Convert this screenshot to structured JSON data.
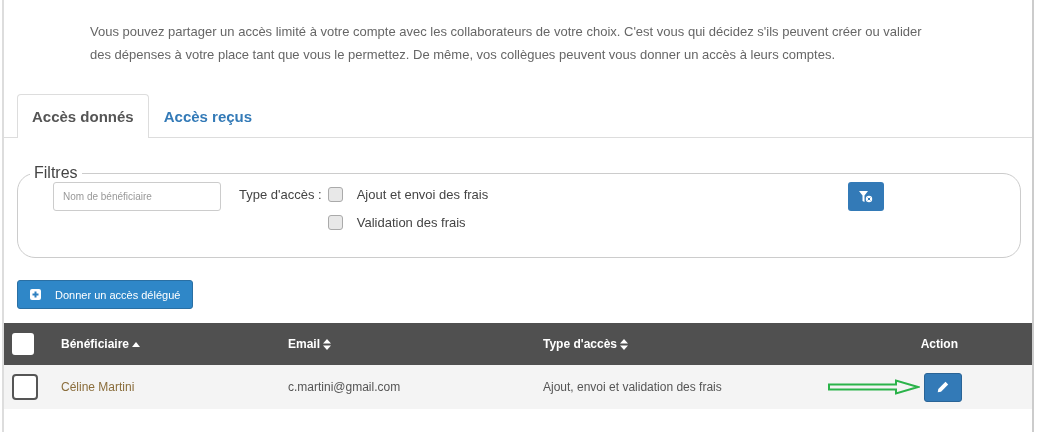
{
  "intro": "Vous pouvez partager un accès limité à votre compte avec les collaborateurs de votre choix. C'est vous qui décidez s'ils peuvent créer ou valider des dépenses à votre place tant que vous le permettez. De même, vos collègues peuvent vous donner un accès à leurs comptes.",
  "tabs": [
    {
      "label": "Accès donnés",
      "selected": true
    },
    {
      "label": "Accès reçus",
      "selected": false
    }
  ],
  "filters": {
    "legend": "Filtres",
    "name_field": {
      "placeholder": "Nom de bénéficiaire"
    },
    "type_label": "Type d'accès :",
    "options": [
      {
        "label": "Ajout et envoi des frais",
        "checked": false
      },
      {
        "label": "Validation des frais",
        "checked": false
      }
    ]
  },
  "add_button": "Donner un accès délégué",
  "table": {
    "select_all": {
      "checked": false
    },
    "columns": [
      {
        "label": "Bénéficiaire",
        "sortable": true,
        "sorted": true
      },
      {
        "label": "Email",
        "sortable": true,
        "sorted": false
      },
      {
        "label": "Type d'accès",
        "sortable": true,
        "sorted": false
      },
      {
        "label": "Action"
      }
    ],
    "rows": [
      {
        "checked": false,
        "beneficiary": "Céline Martini",
        "email": "c.martini@gmail.com",
        "access_type": "Ajout, envoi et validation des frais"
      }
    ]
  }
}
